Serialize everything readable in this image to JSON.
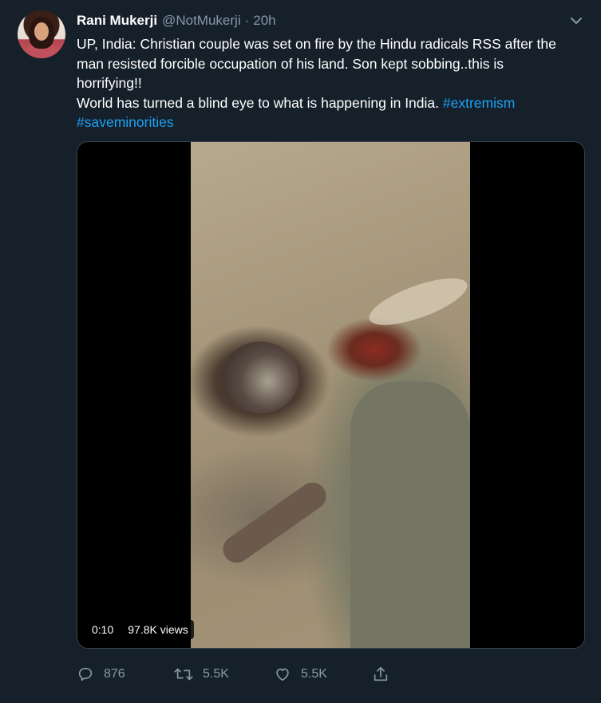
{
  "tweet": {
    "display_name": "Rani Mukerji",
    "handle": "@NotMukerji",
    "separator": "·",
    "time": "20h",
    "text_lines": [
      "UP, India: Christian couple was set on fire by the Hindu radicals RSS after the",
      "man resisted forcible occupation of his land. Son kept sobbing..this is",
      "horrifying!!",
      "World has turned a blind eye to what is happening in India."
    ],
    "hashtags": [
      "#extremism",
      "#saveminorities"
    ]
  },
  "media": {
    "duration": "0:10",
    "views": "97.8K views"
  },
  "actions": {
    "replies": "876",
    "retweets": "5.5K",
    "likes": "5.5K"
  },
  "icons": {
    "caret": "chevron-down-icon",
    "reply": "reply-icon",
    "retweet": "retweet-icon",
    "like": "heart-icon",
    "share": "share-icon"
  },
  "colors": {
    "background": "#15202b",
    "secondary_text": "#8899a6",
    "link": "#1da1f2",
    "border": "#38444d"
  }
}
